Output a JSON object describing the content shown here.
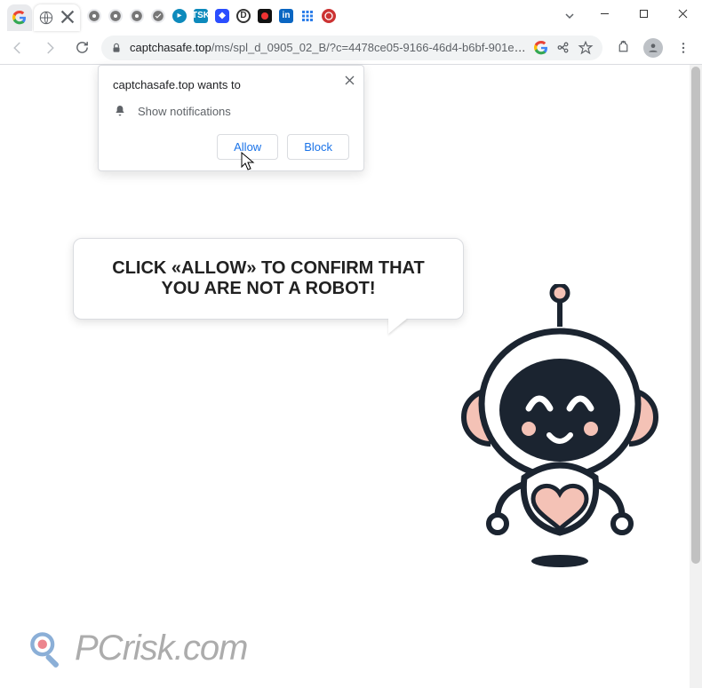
{
  "window": {
    "dropdown_hint": "v"
  },
  "addressbar": {
    "host": "captchasafe.top",
    "path": "/ms/spl_d_0905_02_B/?c=4478ce05-9166-46d4-b6bf-901eceeea..."
  },
  "permission": {
    "origin_line": "captchasafe.top wants to",
    "request_line": "Show notifications",
    "allow_label": "Allow",
    "block_label": "Block"
  },
  "page": {
    "bubble_text": "CLICK «ALLOW» TO CONFIRM THAT YOU ARE NOT A ROBOT!"
  },
  "watermark": {
    "text": "PCrisk.com"
  }
}
